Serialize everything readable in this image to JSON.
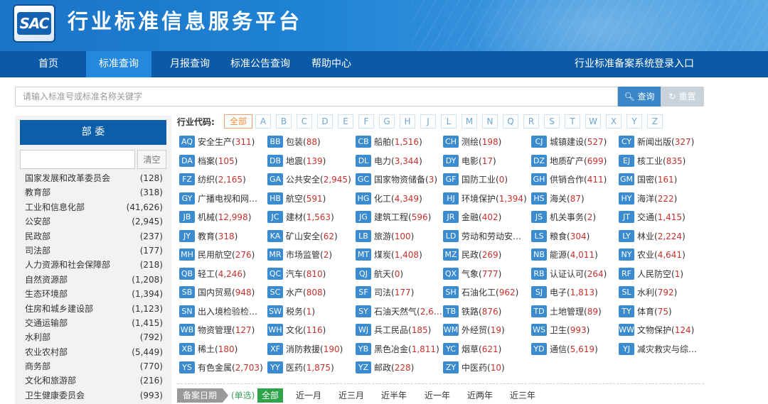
{
  "header": {
    "logo_text": "SAC",
    "title": "行业标准信息服务平台"
  },
  "nav": {
    "items": [
      "首页",
      "标准查询",
      "月报查询",
      "标准公告查询",
      "帮助中心"
    ],
    "active": "标准查询",
    "login": "行业标准备案系统登录入口"
  },
  "search": {
    "placeholder": "请输入标准号或标准名称关键字",
    "query_label": "查询",
    "reset_label": "重置"
  },
  "dept": {
    "title": "部 委",
    "clear_label": "清空",
    "items": [
      {
        "name": "国家发展和改革委员会",
        "count": "(128)"
      },
      {
        "name": "教育部",
        "count": "(318)"
      },
      {
        "name": "工业和信息化部",
        "count": "(41,626)"
      },
      {
        "name": "公安部",
        "count": "(2,945)"
      },
      {
        "name": "民政部",
        "count": "(237)"
      },
      {
        "name": "司法部",
        "count": "(177)"
      },
      {
        "name": "人力资源和社会保障部",
        "count": "(218)"
      },
      {
        "name": "自然资源部",
        "count": "(1,208)"
      },
      {
        "name": "生态环境部",
        "count": "(1,394)"
      },
      {
        "name": "住房和城乡建设部",
        "count": "(1,123)"
      },
      {
        "name": "交通运输部",
        "count": "(1,415)"
      },
      {
        "name": "水利部",
        "count": "(792)"
      },
      {
        "name": "农业农村部",
        "count": "(5,449)"
      },
      {
        "name": "商务部",
        "count": "(770)"
      },
      {
        "name": "文化和旅游部",
        "count": "(216)"
      },
      {
        "name": "卫生健康委员会",
        "count": "(993)"
      }
    ]
  },
  "industry": {
    "label": "行业代码:",
    "letters": [
      "全部",
      "A",
      "B",
      "C",
      "D",
      "E",
      "F",
      "G",
      "H",
      "J",
      "L",
      "M",
      "N",
      "Q",
      "R",
      "S",
      "T",
      "W",
      "X",
      "Y",
      "Z"
    ],
    "items": [
      {
        "code": "AQ",
        "name": "安全生产",
        "num": "311"
      },
      {
        "code": "BB",
        "name": "包装",
        "num": "88"
      },
      {
        "code": "CB",
        "name": "船舶",
        "num": "1,516"
      },
      {
        "code": "CH",
        "name": "测绘",
        "num": "198"
      },
      {
        "code": "CJ",
        "name": "城镇建设",
        "num": "527"
      },
      {
        "code": "CY",
        "name": "新闻出版",
        "num": "327"
      },
      {
        "code": "DA",
        "name": "档案",
        "num": "105"
      },
      {
        "code": "DB",
        "name": "地震",
        "num": "139"
      },
      {
        "code": "DL",
        "name": "电力",
        "num": "3,344"
      },
      {
        "code": "DY",
        "name": "电影",
        "num": "17"
      },
      {
        "code": "DZ",
        "name": "地质矿产",
        "num": "699"
      },
      {
        "code": "EJ",
        "name": "核工业",
        "num": "835"
      },
      {
        "code": "FZ",
        "name": "纺织",
        "num": "2,165"
      },
      {
        "code": "GA",
        "name": "公共安全",
        "num": "2,945"
      },
      {
        "code": "GC",
        "name": "国家物资储备",
        "num": "3"
      },
      {
        "code": "GF",
        "name": "国防工业",
        "num": "0"
      },
      {
        "code": "GH",
        "name": "供销合作",
        "num": "411"
      },
      {
        "code": "GM",
        "name": "国密",
        "num": "161"
      },
      {
        "code": "GY",
        "name": "广播电视和网…",
        "num": ""
      },
      {
        "code": "HB",
        "name": "航空",
        "num": "591"
      },
      {
        "code": "HG",
        "name": "化工",
        "num": "4,349"
      },
      {
        "code": "HJ",
        "name": "环境保护",
        "num": "1,394"
      },
      {
        "code": "HS",
        "name": "海关",
        "num": "87"
      },
      {
        "code": "HY",
        "name": "海洋",
        "num": "222"
      },
      {
        "code": "JB",
        "name": "机械",
        "num": "12,998"
      },
      {
        "code": "JC",
        "name": "建材",
        "num": "1,563"
      },
      {
        "code": "JG",
        "name": "建筑工程",
        "num": "596"
      },
      {
        "code": "JR",
        "name": "金融",
        "num": "402"
      },
      {
        "code": "JS",
        "name": "机关事务",
        "num": "2"
      },
      {
        "code": "JT",
        "name": "交通",
        "num": "1,415"
      },
      {
        "code": "JY",
        "name": "教育",
        "num": "318"
      },
      {
        "code": "KA",
        "name": "矿山安全",
        "num": "62"
      },
      {
        "code": "LB",
        "name": "旅游",
        "num": "100"
      },
      {
        "code": "LD",
        "name": "劳动和劳动安…",
        "num": ""
      },
      {
        "code": "LS",
        "name": "粮食",
        "num": "304"
      },
      {
        "code": "LY",
        "name": "林业",
        "num": "2,224"
      },
      {
        "code": "MH",
        "name": "民用航空",
        "num": "276"
      },
      {
        "code": "MR",
        "name": "市场监管",
        "num": "2"
      },
      {
        "code": "MT",
        "name": "煤炭",
        "num": "1,408"
      },
      {
        "code": "MZ",
        "name": "民政",
        "num": "269"
      },
      {
        "code": "NB",
        "name": "能源",
        "num": "4,011"
      },
      {
        "code": "NY",
        "name": "农业",
        "num": "4,641"
      },
      {
        "code": "QB",
        "name": "轻工",
        "num": "4,246"
      },
      {
        "code": "QC",
        "name": "汽车",
        "num": "810"
      },
      {
        "code": "QJ",
        "name": "航天",
        "num": "0"
      },
      {
        "code": "QX",
        "name": "气象",
        "num": "777"
      },
      {
        "code": "RB",
        "name": "认证认可",
        "num": "264"
      },
      {
        "code": "RF",
        "name": "人民防空",
        "num": "1"
      },
      {
        "code": "SB",
        "name": "国内贸易",
        "num": "948"
      },
      {
        "code": "SC",
        "name": "水产",
        "num": "808"
      },
      {
        "code": "SF",
        "name": "司法",
        "num": "177"
      },
      {
        "code": "SH",
        "name": "石油化工",
        "num": "962"
      },
      {
        "code": "SJ",
        "name": "电子",
        "num": "1,813"
      },
      {
        "code": "SL",
        "name": "水利",
        "num": "792"
      },
      {
        "code": "SN",
        "name": "出入境检验检…",
        "num": ""
      },
      {
        "code": "SW",
        "name": "税务",
        "num": "1"
      },
      {
        "code": "SY",
        "name": "石油天然气",
        "num": "2,6…",
        "trunc": true
      },
      {
        "code": "TB",
        "name": "铁路",
        "num": "876"
      },
      {
        "code": "TD",
        "name": "土地管理",
        "num": "89"
      },
      {
        "code": "TY",
        "name": "体育",
        "num": "75"
      },
      {
        "code": "WB",
        "name": "物资管理",
        "num": "127"
      },
      {
        "code": "WH",
        "name": "文化",
        "num": "116"
      },
      {
        "code": "WJ",
        "name": "兵工民品",
        "num": "185"
      },
      {
        "code": "WM",
        "name": "外经贸",
        "num": "19"
      },
      {
        "code": "WS",
        "name": "卫生",
        "num": "993"
      },
      {
        "code": "WW",
        "name": "文物保护",
        "num": "124"
      },
      {
        "code": "XB",
        "name": "稀土",
        "num": "180"
      },
      {
        "code": "XF",
        "name": "消防救援",
        "num": "190"
      },
      {
        "code": "YB",
        "name": "黑色冶金",
        "num": "1,811"
      },
      {
        "code": "YC",
        "name": "烟草",
        "num": "621"
      },
      {
        "code": "YD",
        "name": "通信",
        "num": "5,619"
      },
      {
        "code": "YJ",
        "name": "减灾救灾与综…",
        "num": ""
      },
      {
        "code": "YS",
        "name": "有色金属",
        "num": "2,703"
      },
      {
        "code": "YY",
        "name": "医药",
        "num": "1,875"
      },
      {
        "code": "YZ",
        "name": "邮政",
        "num": "228"
      },
      {
        "code": "ZY",
        "name": "中医药",
        "num": "10"
      }
    ]
  },
  "date_filter": {
    "label": "备案日期",
    "mode": "(单选)",
    "options": [
      "全部",
      "近一月",
      "近三月",
      "近半年",
      "近一年",
      "近两年",
      "近三年"
    ]
  }
}
